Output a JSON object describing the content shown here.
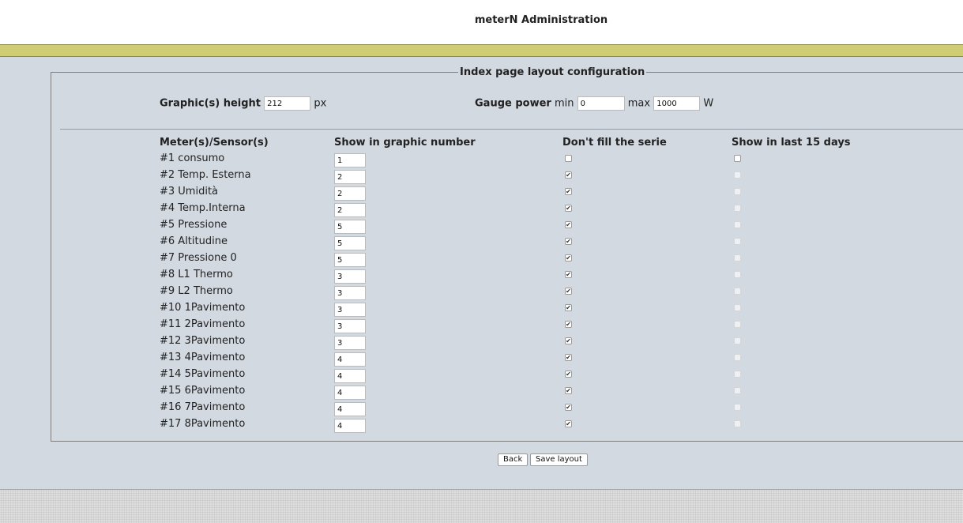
{
  "header": {
    "title": "meterN Administration"
  },
  "config": {
    "legend": "Index page layout configuration",
    "graphic_height": {
      "label": "Graphic(s) height",
      "value": "212",
      "unit": "px"
    },
    "gauge_power": {
      "label": "Gauge power",
      "min_label": "min",
      "min_value": "0",
      "max_label": "max",
      "max_value": "1000",
      "unit": "W"
    }
  },
  "table": {
    "headers": {
      "meters": "Meter(s)/Sensor(s)",
      "graphic": "Show in graphic number",
      "fill": "Don't fill the serie",
      "last15": "Show in last 15 days"
    },
    "rows": [
      {
        "name": "#1 consumo",
        "graphic": "1",
        "no_fill": false,
        "last15": false,
        "last15_disabled": false
      },
      {
        "name": "#2 Temp. Esterna",
        "graphic": "2",
        "no_fill": true,
        "last15": false,
        "last15_disabled": true
      },
      {
        "name": "#3 Umidità",
        "graphic": "2",
        "no_fill": true,
        "last15": false,
        "last15_disabled": true
      },
      {
        "name": "#4 Temp.Interna",
        "graphic": "2",
        "no_fill": true,
        "last15": false,
        "last15_disabled": true
      },
      {
        "name": "#5 Pressione",
        "graphic": "5",
        "no_fill": true,
        "last15": false,
        "last15_disabled": true
      },
      {
        "name": "#6 Altitudine",
        "graphic": "5",
        "no_fill": true,
        "last15": false,
        "last15_disabled": true
      },
      {
        "name": "#7 Pressione 0",
        "graphic": "5",
        "no_fill": true,
        "last15": false,
        "last15_disabled": true
      },
      {
        "name": "#8 L1 Thermo",
        "graphic": "3",
        "no_fill": true,
        "last15": false,
        "last15_disabled": true
      },
      {
        "name": "#9 L2 Thermo",
        "graphic": "3",
        "no_fill": true,
        "last15": false,
        "last15_disabled": true
      },
      {
        "name": "#10 1Pavimento",
        "graphic": "3",
        "no_fill": true,
        "last15": false,
        "last15_disabled": true
      },
      {
        "name": "#11 2Pavimento",
        "graphic": "3",
        "no_fill": true,
        "last15": false,
        "last15_disabled": true
      },
      {
        "name": "#12 3Pavimento",
        "graphic": "3",
        "no_fill": true,
        "last15": false,
        "last15_disabled": true
      },
      {
        "name": "#13 4Pavimento",
        "graphic": "4",
        "no_fill": true,
        "last15": false,
        "last15_disabled": true
      },
      {
        "name": "#14 5Pavimento",
        "graphic": "4",
        "no_fill": true,
        "last15": false,
        "last15_disabled": true
      },
      {
        "name": "#15 6Pavimento",
        "graphic": "4",
        "no_fill": true,
        "last15": false,
        "last15_disabled": true
      },
      {
        "name": "#16 7Pavimento",
        "graphic": "4",
        "no_fill": true,
        "last15": false,
        "last15_disabled": true
      },
      {
        "name": "#17 8Pavimento",
        "graphic": "4",
        "no_fill": true,
        "last15": false,
        "last15_disabled": true
      }
    ]
  },
  "buttons": {
    "back": "Back",
    "save": "Save layout"
  },
  "icons": {
    "checkmark": "check-icon"
  },
  "colors": {
    "accent_bar": "#cfcd74",
    "content_bg": "#d3d9e1"
  }
}
